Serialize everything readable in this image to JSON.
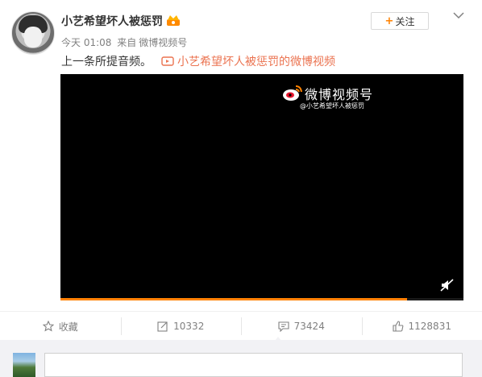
{
  "post": {
    "username": "小艺希望坏人被惩罚",
    "follow_label": "关注",
    "time": "今天 01:08",
    "source_prefix": "来自",
    "source": "微博视频号",
    "text": "上一条所提音频。",
    "video_link_text": "小艺希望坏人被惩罚的微博视频"
  },
  "player": {
    "watermark_title": "微博视频号",
    "watermark_sub": "@小艺希望坏人被惩罚",
    "progress": 0.86
  },
  "actions": [
    {
      "name": "favorite",
      "label": "收藏"
    },
    {
      "name": "repost",
      "label": "10332"
    },
    {
      "name": "comment",
      "label": "73424"
    },
    {
      "name": "like",
      "label": "1128831"
    }
  ],
  "colors": {
    "accent": "#ff8200",
    "link": "#eb7350",
    "meta": "#808080"
  },
  "icons": [
    "star-icon",
    "repost-icon",
    "comment-icon",
    "like-icon",
    "mute-icon",
    "weibo-logo-icon",
    "video-icon",
    "chevron-down-icon",
    "vip-crown-icon"
  ]
}
